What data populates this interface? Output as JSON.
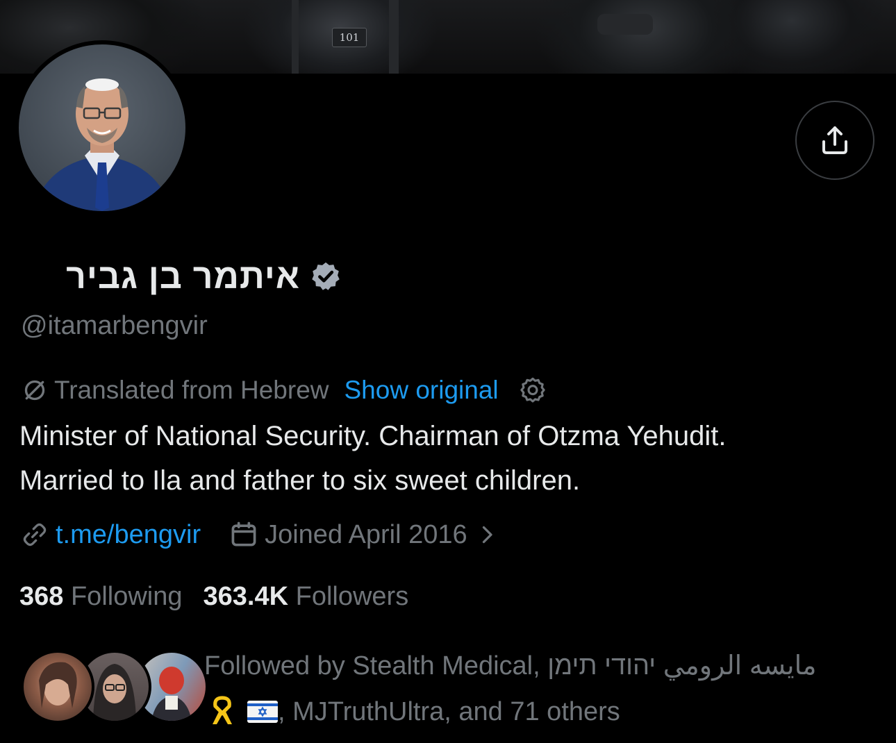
{
  "banner": {
    "badge": "101"
  },
  "profile": {
    "name": "איתמר בן גביר",
    "verified": true,
    "handle": "@itamarbengvir",
    "translation_note": "Translated from Hebrew",
    "show_original": "Show original",
    "bio_line1": "Minister of National Security. Chairman of Otzma Yehudit.",
    "bio_line2": "Married to Ila and father to six sweet children.",
    "link": "t.me/bengvir",
    "joined": "Joined April 2016",
    "following_count": "368",
    "following_label": "Following",
    "followers_count": "363.4K",
    "followers_label": "Followers"
  },
  "followed_by": {
    "prefix": "Followed by Stealth Medical,",
    "name2": "יהודי תימן",
    "name3": "مايسه الرومي",
    "line2_suffix": ", MJTruthUltra, and 71 others"
  },
  "icons": {
    "share": "share-icon",
    "verified": "verified-badge-icon",
    "translate": "translate-icon",
    "settings": "gear-icon",
    "link": "link-icon",
    "calendar": "calendar-icon",
    "chevron": "chevron-right-icon",
    "ribbon": "yellow-ribbon-emoji",
    "flag": "israel-flag-emoji"
  },
  "colors": {
    "background": "#000000",
    "text": "#e7e9ea",
    "muted": "#71767b",
    "link": "#1d9bf0"
  }
}
